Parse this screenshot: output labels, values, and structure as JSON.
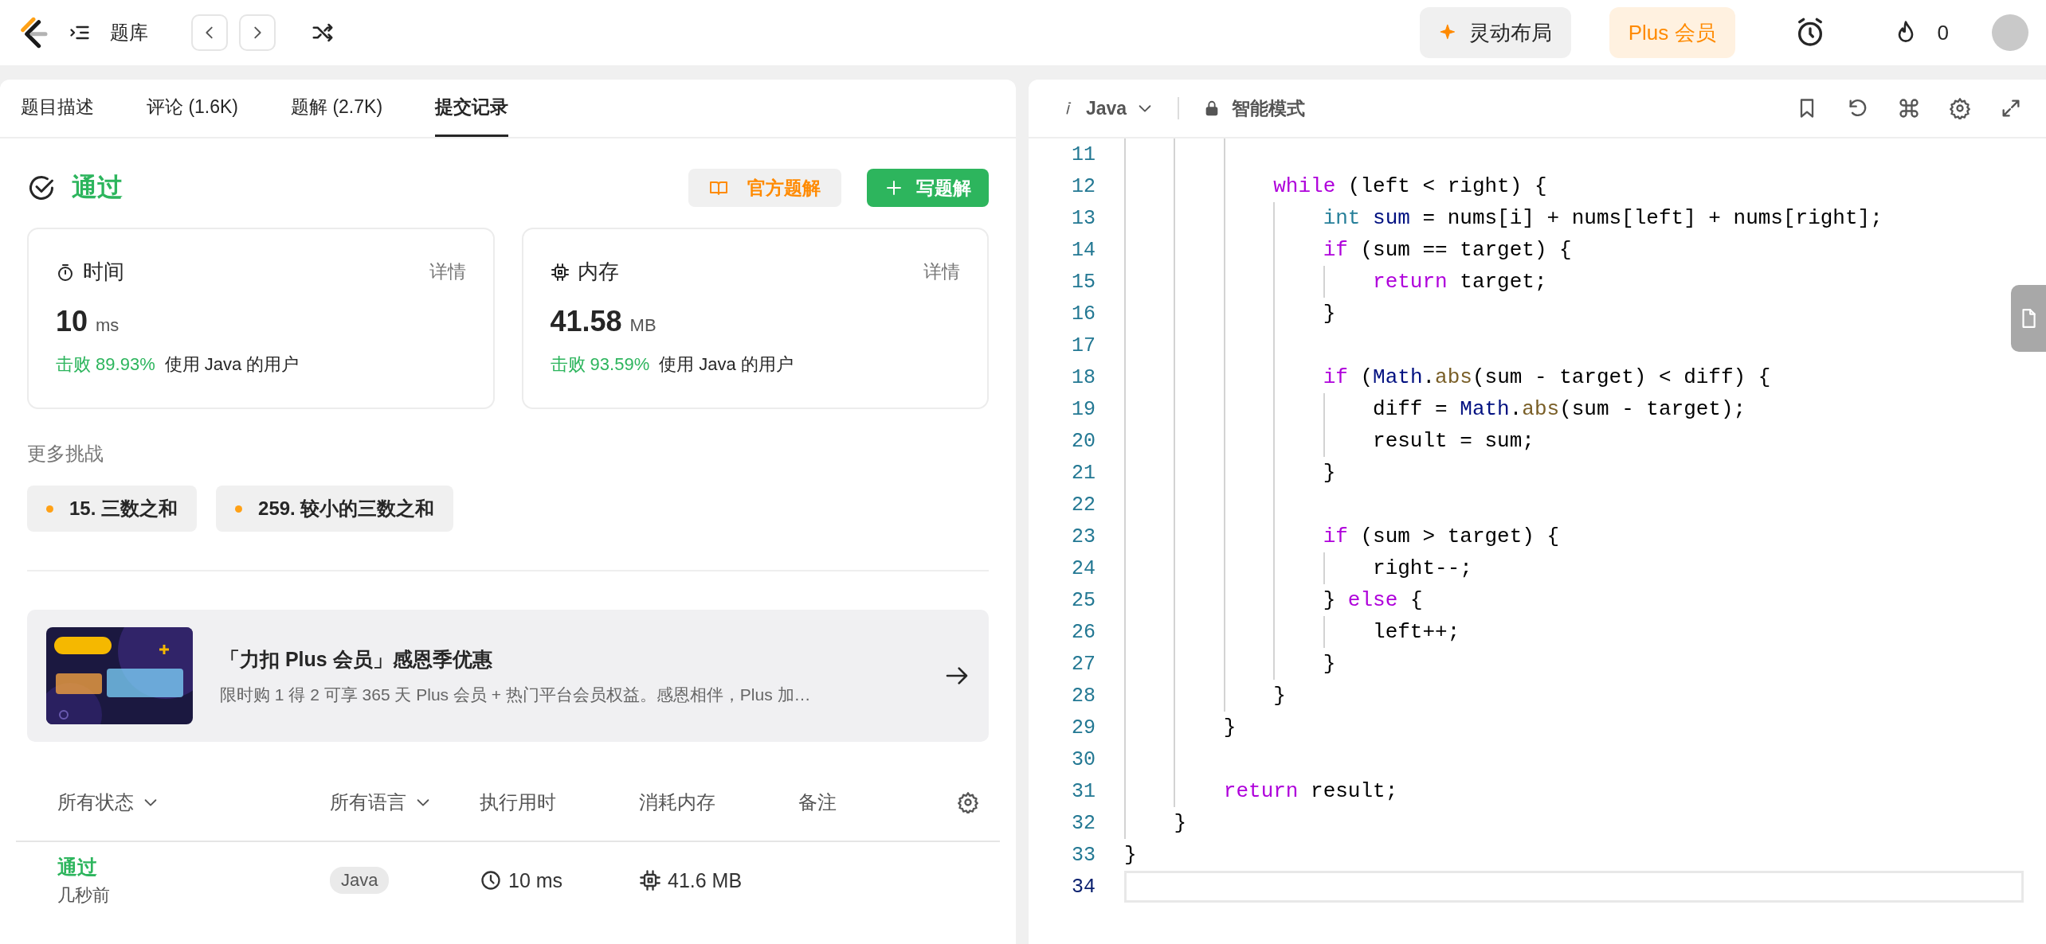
{
  "topbar": {
    "problem_bank": "题库",
    "layout_button": "灵动布局",
    "plus_button": "Plus 会员",
    "streak": "0"
  },
  "tabs": [
    {
      "label": "题目描述",
      "selected": false
    },
    {
      "label": "评论 (1.6K)",
      "selected": false
    },
    {
      "label": "题解 (2.7K)",
      "selected": false
    },
    {
      "label": "提交记录",
      "selected": true
    }
  ],
  "result": {
    "status": "通过",
    "official_button": "官方题解",
    "write_button": "写题解"
  },
  "stats": [
    {
      "kind": "time",
      "title": "时间",
      "detail": "详情",
      "value": "10",
      "unit": "ms",
      "beat": "击败 89.93%",
      "beat_suffix": "使用 Java 的用户"
    },
    {
      "kind": "memory",
      "title": "内存",
      "detail": "详情",
      "value": "41.58",
      "unit": "MB",
      "beat": "击败 93.59%",
      "beat_suffix": "使用 Java 的用户"
    }
  ],
  "more": {
    "title": "更多挑战",
    "items": [
      {
        "label": "15. 三数之和",
        "color": "#ffa116"
      },
      {
        "label": "259. 较小的三数之和",
        "color": "#ffa116"
      }
    ]
  },
  "promo": {
    "title": "「力扣 Plus 会员」感恩季优惠",
    "description": "限时购 1 得 2 可享 365 天 Plus 会员 + 热门平台会员权益。感恩相伴，Plus 加…"
  },
  "submissions": {
    "columns": [
      {
        "label": "所有状态",
        "kind": "filter"
      },
      {
        "label": "所有语言",
        "kind": "filter"
      },
      {
        "label": "执行用时",
        "kind": "plain"
      },
      {
        "label": "消耗内存",
        "kind": "plain"
      },
      {
        "label": "备注",
        "kind": "plain"
      }
    ],
    "rows": [
      {
        "status": "通过",
        "time_ago": "几秒前",
        "language": "Java",
        "runtime": "10 ms",
        "memory": "41.6 MB"
      }
    ]
  },
  "editor": {
    "language": "Java",
    "mode": "智能模式",
    "lines": [
      {
        "number": "11",
        "current": false
      },
      {
        "number": "12",
        "current": false,
        "tokens": [
          {
            "kind": "keyword",
            "text": "            while"
          },
          {
            "kind": "plain",
            "text": " (left < right) {"
          }
        ]
      },
      {
        "number": "13",
        "current": false,
        "tokens": [
          {
            "kind": "type",
            "text": "                int"
          },
          {
            "kind": "variable",
            "text": " sum"
          },
          {
            "kind": "plain",
            "text": " = nums[i] + nums[left] + nums[right];"
          }
        ]
      },
      {
        "number": "14",
        "current": false,
        "tokens": [
          {
            "kind": "keyword",
            "text": "                if"
          },
          {
            "kind": "plain",
            "text": " (sum == target) {"
          }
        ]
      },
      {
        "number": "15",
        "current": false,
        "tokens": [
          {
            "kind": "keyword",
            "text": "                    return"
          },
          {
            "kind": "plain",
            "text": " target;"
          }
        ]
      },
      {
        "number": "16",
        "current": false,
        "tokens": [
          {
            "kind": "plain",
            "text": "                }"
          }
        ]
      },
      {
        "number": "17",
        "current": false
      },
      {
        "number": "18",
        "current": false,
        "tokens": [
          {
            "kind": "keyword",
            "text": "                if"
          },
          {
            "kind": "plain",
            "text": " ("
          },
          {
            "kind": "class",
            "text": "Math"
          },
          {
            "kind": "plain",
            "text": "."
          },
          {
            "kind": "function",
            "text": "abs"
          },
          {
            "kind": "plain",
            "text": "(sum - target) < diff) {"
          }
        ]
      },
      {
        "number": "19",
        "current": false,
        "tokens": [
          {
            "kind": "plain",
            "text": "                    diff = "
          },
          {
            "kind": "class",
            "text": "Math"
          },
          {
            "kind": "plain",
            "text": "."
          },
          {
            "kind": "function",
            "text": "abs"
          },
          {
            "kind": "plain",
            "text": "(sum - target);"
          }
        ]
      },
      {
        "number": "20",
        "current": false,
        "tokens": [
          {
            "kind": "plain",
            "text": "                    result = sum;"
          }
        ]
      },
      {
        "number": "21",
        "current": false,
        "tokens": [
          {
            "kind": "plain",
            "text": "                }"
          }
        ]
      },
      {
        "number": "22",
        "current": false
      },
      {
        "number": "23",
        "current": false,
        "tokens": [
          {
            "kind": "keyword",
            "text": "                if"
          },
          {
            "kind": "plain",
            "text": " (sum > target) {"
          }
        ]
      },
      {
        "number": "24",
        "current": false,
        "tokens": [
          {
            "kind": "plain",
            "text": "                    right--;"
          }
        ]
      },
      {
        "number": "25",
        "current": false,
        "tokens": [
          {
            "kind": "plain",
            "text": "                } "
          },
          {
            "kind": "keyword",
            "text": "else"
          },
          {
            "kind": "plain",
            "text": " {"
          }
        ]
      },
      {
        "number": "26",
        "current": false,
        "tokens": [
          {
            "kind": "plain",
            "text": "                    left++;"
          }
        ]
      },
      {
        "number": "27",
        "current": false,
        "tokens": [
          {
            "kind": "plain",
            "text": "                }"
          }
        ]
      },
      {
        "number": "28",
        "current": false,
        "tokens": [
          {
            "kind": "plain",
            "text": "            }"
          }
        ]
      },
      {
        "number": "29",
        "current": false,
        "tokens": [
          {
            "kind": "plain",
            "text": "        }"
          }
        ]
      },
      {
        "number": "30",
        "current": false
      },
      {
        "number": "31",
        "current": false,
        "tokens": [
          {
            "kind": "keyword",
            "text": "        return"
          },
          {
            "kind": "plain",
            "text": " result;"
          }
        ]
      },
      {
        "number": "32",
        "current": false,
        "tokens": [
          {
            "kind": "plain",
            "text": "    }"
          }
        ]
      },
      {
        "number": "33",
        "current": false,
        "tokens": [
          {
            "kind": "plain",
            "text": "}"
          }
        ]
      },
      {
        "number": "34",
        "current": true
      }
    ]
  }
}
